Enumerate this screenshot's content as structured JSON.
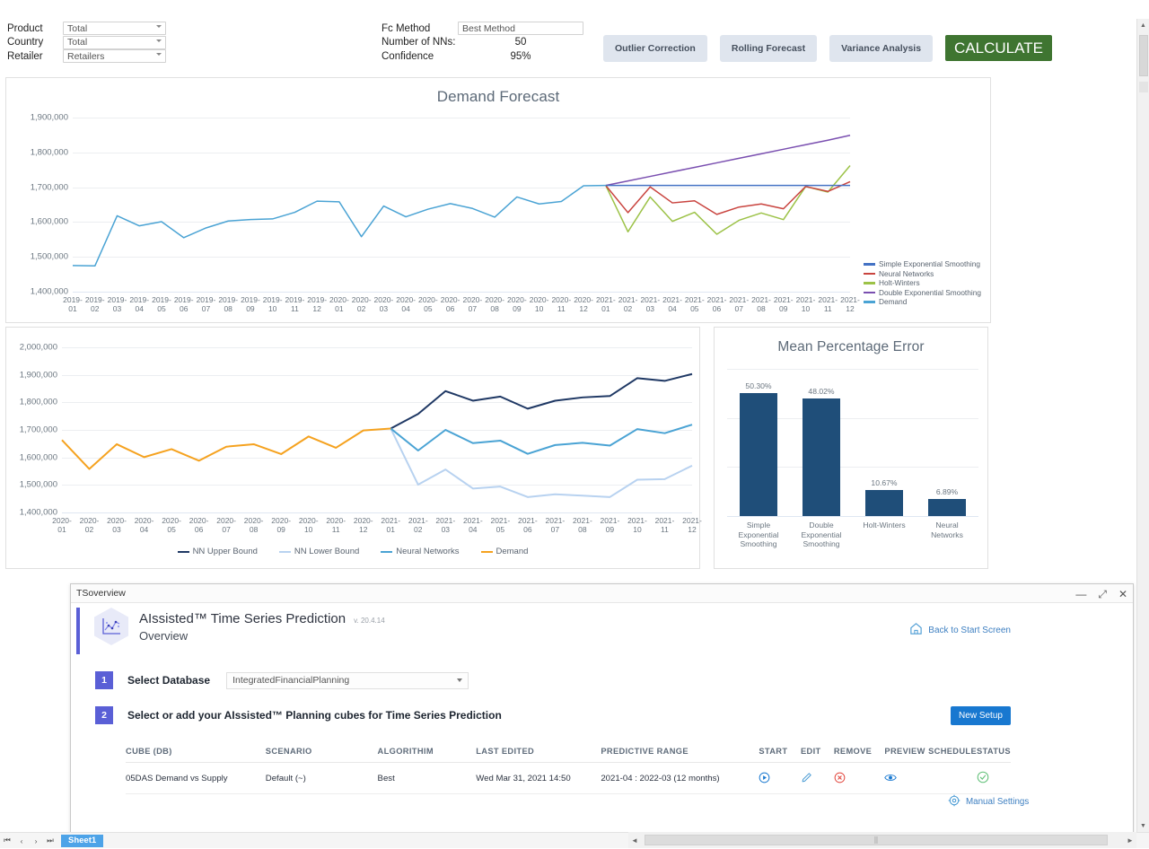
{
  "topbar": {
    "filters": [
      {
        "label": "Product",
        "value": "Total"
      },
      {
        "label": "Country",
        "value": "Total"
      },
      {
        "label": "Retailer",
        "value": "Retailers"
      }
    ],
    "settings": [
      {
        "label": "Fc Method",
        "value": "Best Method",
        "type": "select"
      },
      {
        "label": "Number of NNs:",
        "value": "50",
        "type": "text"
      },
      {
        "label": "Confidence",
        "value": "95%",
        "type": "text"
      }
    ],
    "buttons": [
      {
        "label": "Outlier Correction",
        "style": "secondary"
      },
      {
        "label": "Rolling Forecast",
        "style": "secondary"
      },
      {
        "label": "Variance Analysis",
        "style": "secondary"
      },
      {
        "label": "CALCULATE",
        "style": "primary"
      }
    ],
    "accent_green": "#3f7531"
  },
  "chart_data": [
    {
      "id": "demand_forecast",
      "type": "line",
      "title": "Demand Forecast",
      "xlabel": "",
      "ylabel": "",
      "ylim": [
        1400000,
        1900000
      ],
      "yticks": [
        "1,400,000",
        "1,500,000",
        "1,600,000",
        "1,700,000",
        "1,800,000",
        "1,900,000"
      ],
      "grid": true,
      "legend_position": "right",
      "categories": [
        "2019-01",
        "2019-02",
        "2019-03",
        "2019-04",
        "2019-05",
        "2019-06",
        "2019-07",
        "2019-08",
        "2019-09",
        "2019-10",
        "2019-11",
        "2019-12",
        "2020-01",
        "2020-02",
        "2020-03",
        "2020-04",
        "2020-05",
        "2020-06",
        "2020-07",
        "2020-08",
        "2020-09",
        "2020-10",
        "2020-11",
        "2020-12",
        "2021-01",
        "2021-02",
        "2021-03",
        "2021-04",
        "2021-05",
        "2021-06",
        "2021-07",
        "2021-08",
        "2021-09",
        "2021-10",
        "2021-11",
        "2021-12"
      ],
      "series": [
        {
          "name": "Demand",
          "color": "#4aa3d4",
          "values": [
            1475000,
            1474000,
            1618000,
            1589000,
            1601000,
            1555000,
            1583000,
            1603000,
            1607000,
            1609000,
            1628000,
            1660000,
            1658000,
            1558000,
            1646000,
            1615000,
            1637000,
            1653000,
            1639000,
            1614000,
            1672000,
            1652000,
            1659000,
            1704000,
            1705000,
            null,
            null,
            null,
            null,
            null,
            null,
            null,
            null,
            null,
            null,
            null
          ]
        },
        {
          "name": "Simple Exponential Smoothing",
          "color": "#4472c4",
          "values": [
            null,
            null,
            null,
            null,
            null,
            null,
            null,
            null,
            null,
            null,
            null,
            null,
            null,
            null,
            null,
            null,
            null,
            null,
            null,
            null,
            null,
            null,
            null,
            null,
            1705000,
            1705000,
            1705000,
            1705000,
            1705000,
            1705000,
            1705000,
            1705000,
            1705000,
            1705000,
            1705000,
            1705000
          ]
        },
        {
          "name": "Neural Networks",
          "color": "#c9443f",
          "values": [
            null,
            null,
            null,
            null,
            null,
            null,
            null,
            null,
            null,
            null,
            null,
            null,
            null,
            null,
            null,
            null,
            null,
            null,
            null,
            null,
            null,
            null,
            null,
            null,
            1705000,
            1627000,
            1701000,
            1655000,
            1661000,
            1622000,
            1643000,
            1652000,
            1638000,
            1702000,
            1688000,
            1716000
          ]
        },
        {
          "name": "Holt-Winters",
          "color": "#9cc247",
          "values": [
            null,
            null,
            null,
            null,
            null,
            null,
            null,
            null,
            null,
            null,
            null,
            null,
            null,
            null,
            null,
            null,
            null,
            null,
            null,
            null,
            null,
            null,
            null,
            null,
            1705000,
            1572000,
            1672000,
            1602000,
            1628000,
            1565000,
            1605000,
            1626000,
            1607000,
            1702000,
            1686000,
            1762000
          ]
        },
        {
          "name": "Double Exponential Smoothing",
          "color": "#7a4fb0",
          "values": [
            null,
            null,
            null,
            null,
            null,
            null,
            null,
            null,
            null,
            null,
            null,
            null,
            null,
            null,
            null,
            null,
            null,
            null,
            null,
            null,
            null,
            null,
            null,
            null,
            1705000,
            1718000,
            1731000,
            1744000,
            1757000,
            1770000,
            1783000,
            1796000,
            1809000,
            1822000,
            1835000,
            1849000
          ]
        }
      ]
    },
    {
      "id": "nn_bounds",
      "type": "line",
      "title": "",
      "xlabel": "",
      "ylabel": "",
      "ylim": [
        1400000,
        2000000
      ],
      "yticks": [
        "1,400,000",
        "1,500,000",
        "1,600,000",
        "1,700,000",
        "1,800,000",
        "1,900,000",
        "2,000,000"
      ],
      "grid": true,
      "legend_position": "bottom",
      "categories": [
        "2020-01",
        "2020-02",
        "2020-03",
        "2020-04",
        "2020-05",
        "2020-06",
        "2020-07",
        "2020-08",
        "2020-09",
        "2020-10",
        "2020-11",
        "2020-12",
        "2021-01",
        "2021-02",
        "2021-03",
        "2021-04",
        "2021-05",
        "2021-06",
        "2021-07",
        "2021-08",
        "2021-09",
        "2021-10",
        "2021-11",
        "2021-12"
      ],
      "series": [
        {
          "name": "Demand",
          "color": "#f5a21f",
          "values": [
            1663000,
            1558000,
            1648000,
            1601000,
            1630000,
            1588000,
            1639000,
            1648000,
            1612000,
            1676000,
            1635000,
            1698000,
            1705000,
            null,
            null,
            null,
            null,
            null,
            null,
            null,
            null,
            null,
            null,
            null
          ]
        },
        {
          "name": "NN Upper Bound",
          "color": "#1f3864",
          "values": [
            null,
            null,
            null,
            null,
            null,
            null,
            null,
            null,
            null,
            null,
            null,
            null,
            1705000,
            1758000,
            1841000,
            1806000,
            1821000,
            1777000,
            1806000,
            1818000,
            1823000,
            1888000,
            1878000,
            1903000
          ]
        },
        {
          "name": "Neural Networks",
          "color": "#4aa3d4",
          "values": [
            null,
            null,
            null,
            null,
            null,
            null,
            null,
            null,
            null,
            null,
            null,
            null,
            1705000,
            1625000,
            1700000,
            1652000,
            1661000,
            1613000,
            1645000,
            1653000,
            1643000,
            1703000,
            1688000,
            1719000
          ]
        },
        {
          "name": "NN Lower Bound",
          "color": "#b8d2f0",
          "values": [
            null,
            null,
            null,
            null,
            null,
            null,
            null,
            null,
            null,
            null,
            null,
            null,
            1705000,
            1501000,
            1556000,
            1487000,
            1494000,
            1456000,
            1466000,
            1461000,
            1456000,
            1519000,
            1521000,
            1570000
          ]
        }
      ]
    },
    {
      "id": "mean_percentage_error",
      "type": "bar",
      "title": "Mean Percentage Error",
      "xlabel": "",
      "ylabel": "",
      "ylim": [
        0,
        60
      ],
      "grid": true,
      "bar_color": "#1f4e79",
      "categories": [
        "Simple Exponential Smoothing",
        "Double Exponential Smoothing",
        "Holt-Winters",
        "Neural Networks"
      ],
      "values": [
        50.3,
        48.02,
        10.67,
        6.89
      ],
      "value_labels": [
        "50.30%",
        "48.02%",
        "10.67%",
        "6.89%"
      ]
    }
  ],
  "dialog": {
    "window_title": "TSoverview",
    "window_controls": {
      "minimize": "—",
      "restore": "⤢",
      "close": "✕"
    },
    "app_name": "AIssisted™ Time Series Prediction",
    "app_version": "v. 20.4.14",
    "app_subtitle": "Overview",
    "back_link": "Back to Start Screen",
    "step1": {
      "number": "1",
      "label": "Select Database",
      "database": "IntegratedFinancialPlanning"
    },
    "step2": {
      "number": "2",
      "label": "Select or add your AIssisted™ Planning cubes for Time Series Prediction"
    },
    "new_setup_button": "New Setup",
    "manual_settings": "Manual Settings",
    "table": {
      "headers": [
        "CUBE (DB)",
        "SCENARIO",
        "ALGORITHIM",
        "LAST EDITED",
        "PREDICTIVE RANGE",
        "START",
        "EDIT",
        "REMOVE",
        "PREVIEW",
        "SCHEDULE",
        "STATUS"
      ],
      "rows": [
        {
          "cube": "05DAS Demand vs Supply",
          "scenario": "Default (~)",
          "algorithm": "Best",
          "last_edited": "Wed Mar 31, 2021 14:50",
          "predictive_range": "2021-04 : 2022-03 (12 months)",
          "start_icon": "play-icon",
          "edit_icon": "pencil-icon",
          "remove_icon": "remove-circle-icon",
          "preview_icon": "eye-icon",
          "schedule_icon": "",
          "status_icon": "check-circle-icon"
        }
      ]
    },
    "sheet_tab": "Sheet1",
    "nav_buttons": [
      "first",
      "prev",
      "next",
      "last"
    ]
  }
}
